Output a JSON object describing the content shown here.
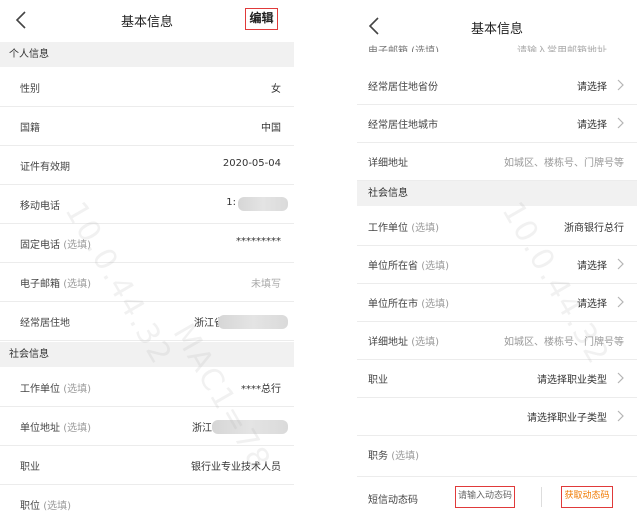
{
  "left": {
    "title": "基本信息",
    "edit_label": "编辑",
    "sections": {
      "personal": "个人信息",
      "social": "社会信息"
    },
    "rows": [
      {
        "label": "性别",
        "opt": "",
        "value": "女"
      },
      {
        "label": "国籍",
        "opt": "",
        "value": "中国"
      },
      {
        "label": "证件有效期",
        "opt": "",
        "value": "2020-05-04"
      },
      {
        "label": "移动电话",
        "opt": "",
        "value": "1:"
      },
      {
        "label": "固定电话",
        "opt": "(选填)",
        "value": "*********"
      },
      {
        "label": "电子邮箱",
        "opt": "(选填)",
        "value": "未填写"
      },
      {
        "label": "经常居住地",
        "opt": "",
        "value": "浙江省"
      }
    ],
    "social_rows": [
      {
        "label": "工作单位",
        "opt": "(选填)",
        "value": "****总行"
      },
      {
        "label": "单位地址",
        "opt": "(选填)",
        "value": "浙江"
      },
      {
        "label": "职业",
        "opt": "",
        "value": "银行业专业技术人员"
      },
      {
        "label": "职位",
        "opt": "(选填)",
        "value": ""
      }
    ]
  },
  "right": {
    "title": "基本信息",
    "cut_row": {
      "label": "电子邮箱 (选填)",
      "value": "请输入常用邮箱地址"
    },
    "rows": [
      {
        "label": "经常居住地省份",
        "opt": "",
        "value": "请选择"
      },
      {
        "label": "经常居住地城市",
        "opt": "",
        "value": "请选择"
      },
      {
        "label": "详细地址",
        "opt": "",
        "value": "如城区、楼栋号、门牌号等"
      }
    ],
    "section_social": "社会信息",
    "social_rows": [
      {
        "label": "工作单位",
        "opt": "(选填)",
        "value": "浙商银行总行"
      },
      {
        "label": "单位所在省",
        "opt": "(选填)",
        "value": "请选择"
      },
      {
        "label": "单位所在市",
        "opt": "(选填)",
        "value": "请选择"
      },
      {
        "label": "详细地址",
        "opt": "(选填)",
        "value": "如城区、楼栋号、门牌号等"
      },
      {
        "label": "职业",
        "opt": "",
        "value": "请选择职业类型"
      },
      {
        "label": "",
        "opt": "",
        "value": "请选择职业子类型"
      },
      {
        "label": "职务",
        "opt": "(选填)",
        "value": ""
      }
    ],
    "sms": {
      "label": "短信动态码",
      "placeholder": "请输入动态码",
      "button": "获取动态码"
    }
  },
  "watermarks": [
    "10.0.44.32",
    "MAC1=78",
    "10.0.44.32"
  ]
}
